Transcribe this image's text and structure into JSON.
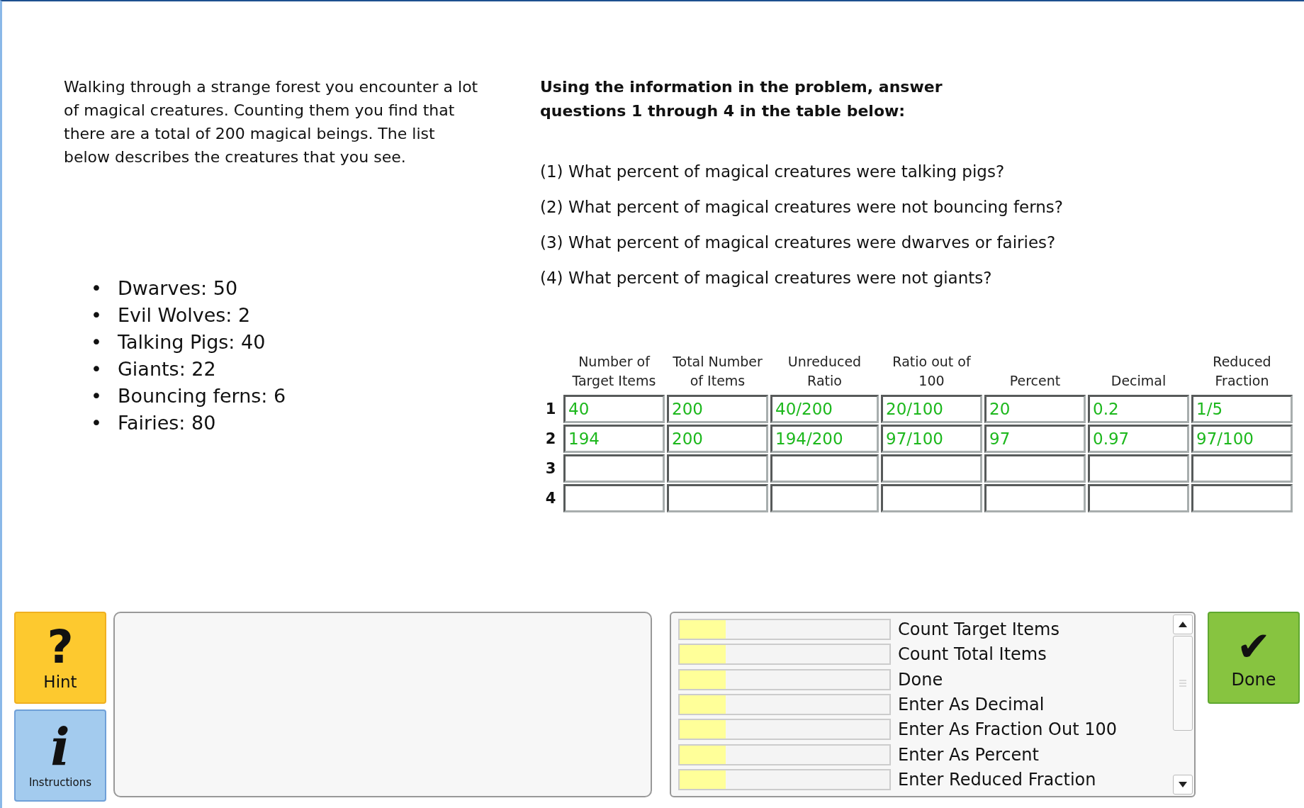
{
  "problem": {
    "text": "Walking through a strange forest you encounter a lot of magical creatures. Counting them you find that there are a total of 200 magical beings. The list below describes the creatures that you see.",
    "bullet": "•",
    "creatures": [
      "Dwarves: 50",
      "Evil Wolves: 2",
      "Talking Pigs: 40",
      "Giants: 22",
      "Bouncing ferns: 6",
      "Fairies: 80"
    ]
  },
  "instructions": {
    "heading": "Using the information in the problem, answer questions 1 through 4 in the table below:",
    "questions": [
      "(1) What percent of magical creatures were talking pigs?",
      "(2) What percent of magical creatures were not bouncing ferns?",
      "(3) What percent of magical creatures were dwarves or fairies?",
      "(4) What percent of magical creatures were not giants?"
    ]
  },
  "table": {
    "columns": [
      "Number of Target Items",
      "Total Number of Items",
      "Unreduced Ratio",
      "Ratio out of 100",
      "Percent",
      "Decimal",
      "Reduced Fraction"
    ],
    "rows": [
      {
        "label": "1",
        "cells": [
          "40",
          "200",
          "40/200",
          "20/100",
          "20",
          "0.2",
          "1/5"
        ]
      },
      {
        "label": "2",
        "cells": [
          "194",
          "200",
          "194/200",
          "97/100",
          "97",
          "0.97",
          "97/100"
        ]
      },
      {
        "label": "3",
        "cells": []
      },
      {
        "label": "4",
        "cells": []
      }
    ]
  },
  "hint_button": {
    "icon": "?",
    "label": "Hint"
  },
  "instructions_button": {
    "icon": "i",
    "label": "Instructions"
  },
  "skills": [
    {
      "label": "Count Target Items",
      "level": 0.22
    },
    {
      "label": "Count Total Items",
      "level": 0.22
    },
    {
      "label": "Done",
      "level": 0.22
    },
    {
      "label": "Enter As Decimal",
      "level": 0.22
    },
    {
      "label": "Enter As Fraction Out 100",
      "level": 0.22
    },
    {
      "label": "Enter As Percent",
      "level": 0.22
    },
    {
      "label": "Enter Reduced Fraction",
      "level": 0.22
    }
  ],
  "done_button": {
    "icon": "✔",
    "label": "Done"
  }
}
